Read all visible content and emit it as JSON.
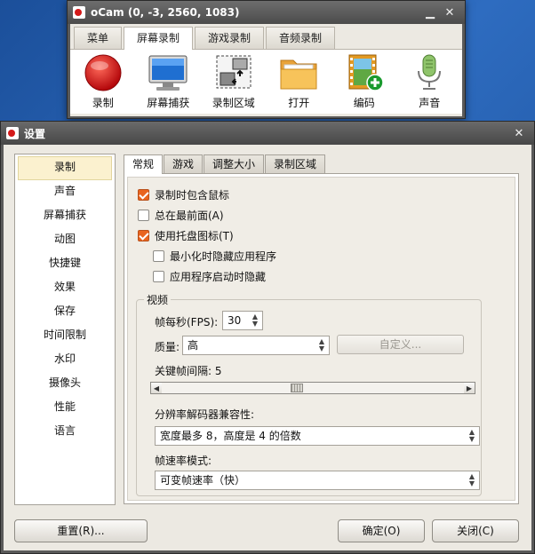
{
  "main_window": {
    "title": "oCam (0, -3, 2560, 1083)",
    "tabs": [
      "菜单",
      "屏幕录制",
      "游戏录制",
      "音频录制"
    ],
    "active_tab": 1,
    "tools": [
      {
        "label": "录制",
        "icon": "record-icon"
      },
      {
        "label": "屏幕捕获",
        "icon": "monitor-icon"
      },
      {
        "label": "录制区域",
        "icon": "resize-area-icon"
      },
      {
        "label": "打开",
        "icon": "folder-icon"
      },
      {
        "label": "编码",
        "icon": "film-add-icon"
      },
      {
        "label": "声音",
        "icon": "microphone-icon"
      }
    ]
  },
  "dialog": {
    "title": "设置",
    "sidebar": [
      "录制",
      "声音",
      "屏幕捕获",
      "动图",
      "快捷键",
      "效果",
      "保存",
      "时间限制",
      "水印",
      "摄像头",
      "性能",
      "语言"
    ],
    "sidebar_active": 0,
    "tabs": [
      "常规",
      "游戏",
      "调整大小",
      "录制区域"
    ],
    "active_tab": 0,
    "options": [
      {
        "label": "录制时包含鼠标",
        "checked": true
      },
      {
        "label": "总在最前面(A)",
        "checked": false
      },
      {
        "label": "使用托盘图标(T)",
        "checked": true
      },
      {
        "label": "最小化时隐藏应用程序",
        "checked": false
      },
      {
        "label": "应用程序启动时隐藏",
        "checked": false
      }
    ],
    "video": {
      "legend": "视频",
      "fps_label": "帧每秒(FPS):",
      "fps_value": "30",
      "quality_label": "质量:",
      "quality_value": "高",
      "custom_button": "自定义...",
      "keyframe_label": "关键帧间隔: 5",
      "keyframe_value": 5,
      "resolution_label": "分辨率解码器兼容性:",
      "resolution_value": "宽度最多 8，高度是 4 的倍数",
      "framerate_label": "帧速率模式:",
      "framerate_value": "可变帧速率（快）"
    },
    "buttons": {
      "reset": "重置(R)...",
      "ok": "确定(O)",
      "close": "关闭(C)"
    }
  }
}
